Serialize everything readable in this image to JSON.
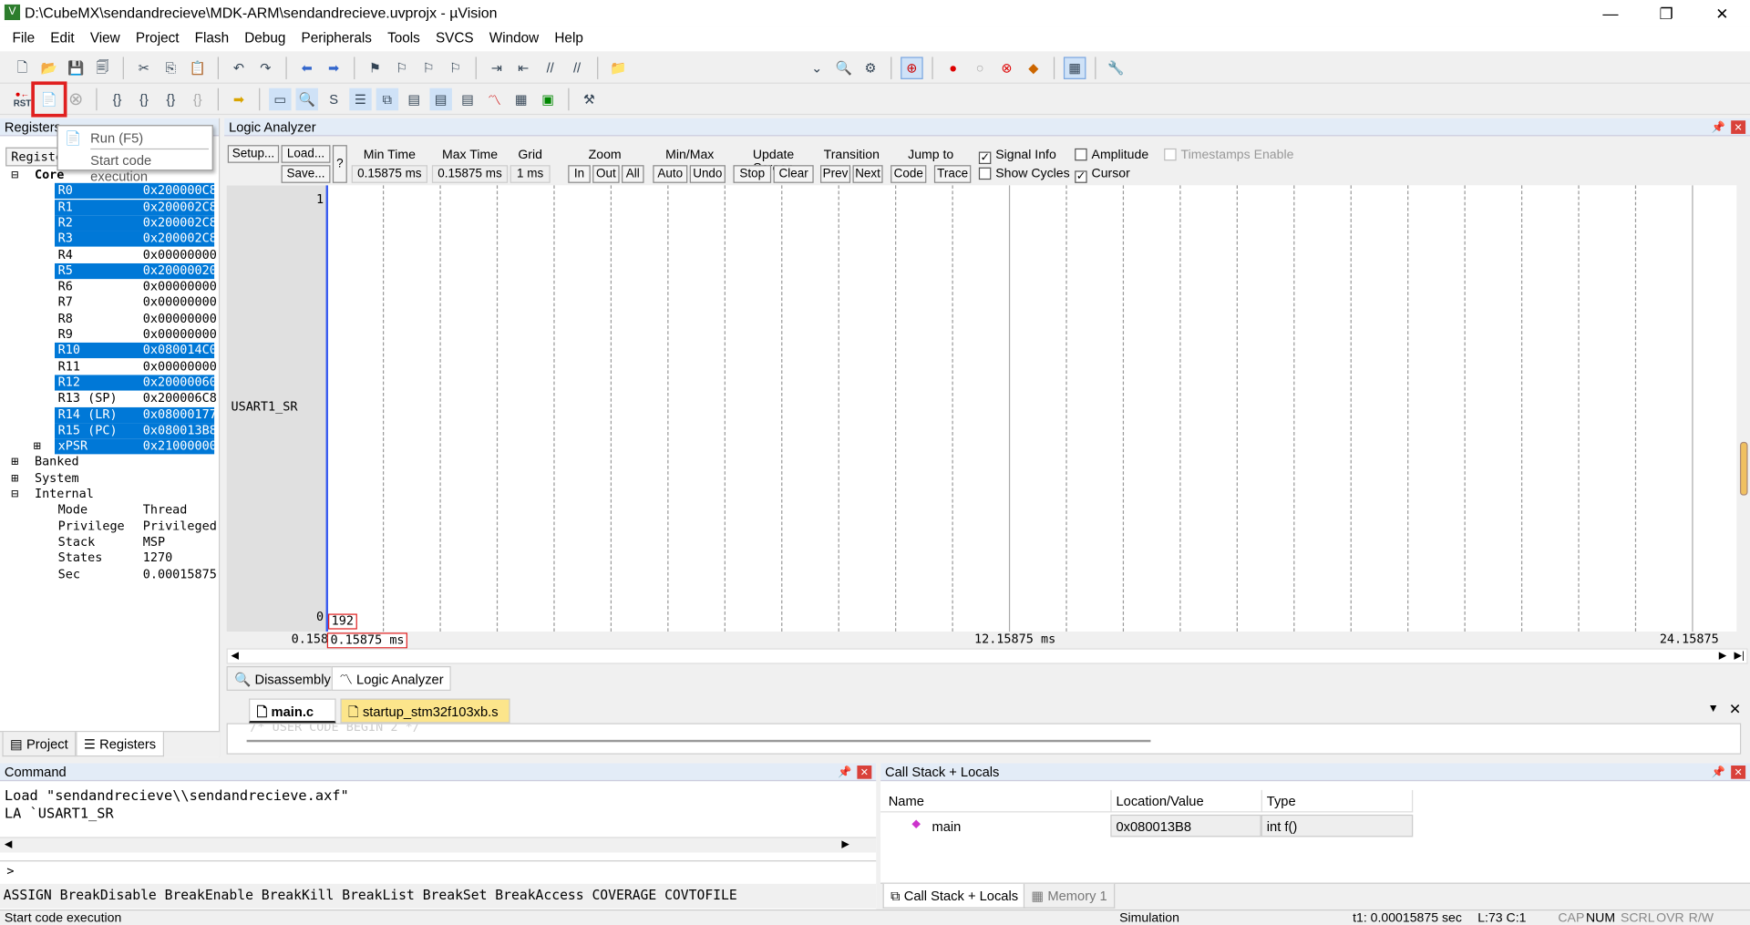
{
  "window": {
    "title": "D:\\CubeMX\\sendandrecieve\\MDK-ARM\\sendandrecieve.uvprojx - µVision",
    "minimize": "—",
    "maximize": "❐",
    "close": "✕"
  },
  "menu": [
    "File",
    "Edit",
    "View",
    "Project",
    "Flash",
    "Debug",
    "Peripherals",
    "Tools",
    "SVCS",
    "Window",
    "Help"
  ],
  "tooltip": {
    "title": "Run (F5)",
    "desc": "Start code execution"
  },
  "toolbar2": {
    "rst": "RST"
  },
  "registers": {
    "title": "Registers",
    "col": "Register",
    "core": "Core",
    "rows": [
      {
        "n": "R0",
        "v": "0x200000C8",
        "s": true
      },
      {
        "n": "R1",
        "v": "0x200002C8",
        "s": true
      },
      {
        "n": "R2",
        "v": "0x200002C8",
        "s": true
      },
      {
        "n": "R3",
        "v": "0x200002C8",
        "s": true
      },
      {
        "n": "R4",
        "v": "0x00000000",
        "s": false
      },
      {
        "n": "R5",
        "v": "0x20000020",
        "s": true
      },
      {
        "n": "R6",
        "v": "0x00000000",
        "s": false
      },
      {
        "n": "R7",
        "v": "0x00000000",
        "s": false
      },
      {
        "n": "R8",
        "v": "0x00000000",
        "s": false
      },
      {
        "n": "R9",
        "v": "0x00000000",
        "s": false
      },
      {
        "n": "R10",
        "v": "0x080014C0",
        "s": true
      },
      {
        "n": "R11",
        "v": "0x00000000",
        "s": false
      },
      {
        "n": "R12",
        "v": "0x20000060",
        "s": true
      },
      {
        "n": "R13 (SP)",
        "v": "0x200006C8",
        "s": false
      },
      {
        "n": "R14 (LR)",
        "v": "0x08000177",
        "s": true
      },
      {
        "n": "R15 (PC)",
        "v": "0x080013B8",
        "s": true
      },
      {
        "n": "xPSR",
        "v": "0x21000000",
        "s": true
      }
    ],
    "groups": [
      "Banked",
      "System",
      "Internal"
    ],
    "internal": [
      {
        "n": "Mode",
        "v": "Thread"
      },
      {
        "n": "Privilege",
        "v": "Privileged"
      },
      {
        "n": "Stack",
        "v": "MSP"
      },
      {
        "n": "States",
        "v": "1270"
      },
      {
        "n": "Sec",
        "v": "0.00015875"
      }
    ],
    "tabs": [
      "Project",
      "Registers"
    ]
  },
  "la": {
    "title": "Logic Analyzer",
    "setup": "Setup...",
    "load": "Load...",
    "save": "Save...",
    "help": "?",
    "min_time_label": "Min Time",
    "min_time": "0.15875 ms",
    "max_time_label": "Max Time",
    "max_time": "0.15875 ms",
    "grid_label": "Grid",
    "grid": "1 ms",
    "zoom": "Zoom",
    "zin": "In",
    "zout": "Out",
    "zall": "All",
    "minmax": "Min/Max",
    "auto": "Auto",
    "undo": "Undo",
    "update": "Update Screen",
    "stop": "Stop",
    "clear": "Clear",
    "transition": "Transition",
    "prev": "Prev",
    "next": "Next",
    "jump": "Jump to",
    "code": "Code",
    "trace": "Trace",
    "signal_info": "Signal Info",
    "show_cycles": "Show Cycles",
    "amplitude": "Amplitude",
    "cursor": "Cursor",
    "timestamps": "Timestamps Enable",
    "signal_info_checked": true,
    "show_cycles_checked": false,
    "amplitude_checked": false,
    "cursor_checked": true,
    "signal": "USART1_SR",
    "y_max": "1",
    "y_min": "0",
    "cursor_value": "192",
    "axis_left": "0.1587",
    "axis_cursor": "0.15875 ms",
    "axis_mid": "12.15875 ms",
    "axis_right": "24.15875 ms",
    "tabs": [
      "Disassembly",
      "Logic Analyzer"
    ]
  },
  "editor": {
    "tabs": [
      "main.c",
      "startup_stm32f103xb.s"
    ],
    "line": "  /* USER CODE BEGIN 2 */"
  },
  "command": {
    "title": "Command",
    "lines": [
      "Load \"sendandrecieve\\\\sendandrecieve.axf\"",
      "LA `USART1_SR"
    ],
    "prompt": ">",
    "hint": "ASSIGN BreakDisable BreakEnable BreakKill BreakList BreakSet BreakAccess COVERAGE COVTOFILE"
  },
  "callstack": {
    "title": "Call Stack + Locals",
    "cols": [
      "Name",
      "Location/Value",
      "Type"
    ],
    "row": {
      "name": "main",
      "loc": "0x080013B8",
      "type": "int f()"
    },
    "tabs": [
      "Call Stack + Locals",
      "Memory 1"
    ]
  },
  "status": {
    "left": "Start code execution",
    "mode": "Simulation",
    "t1": "t1: 0.00015875 sec",
    "pos": "L:73 C:1",
    "caps": [
      "CAP",
      "NUM",
      "SCRL",
      "OVR",
      "R/W"
    ]
  },
  "colors": {
    "selection": "#0078d7",
    "highlight": "#e02020",
    "header": "#e3ecf7"
  }
}
